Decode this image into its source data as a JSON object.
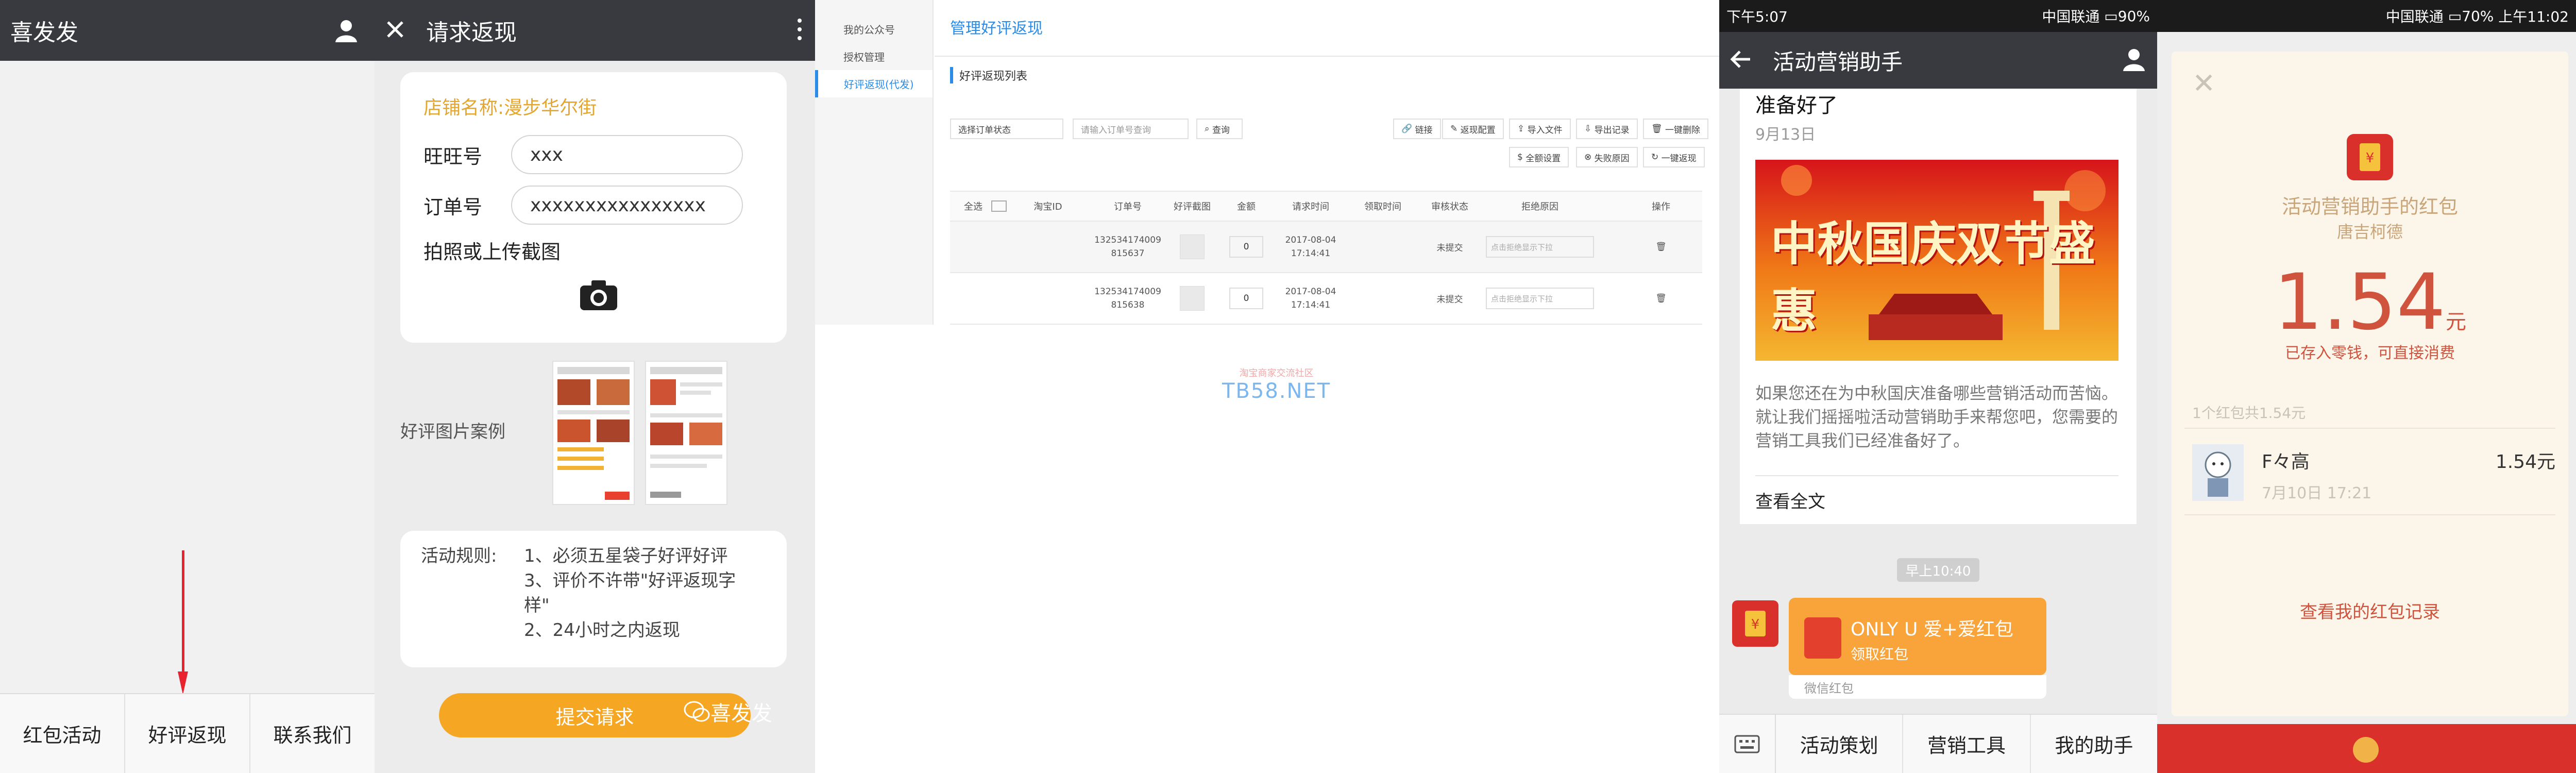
{
  "panel1": {
    "title": "喜发发",
    "tabs": [
      "红包活动",
      "好评返现",
      "联系我们"
    ]
  },
  "panel2": {
    "title": "请求返现",
    "shop_name": "店铺名称:漫步华尔街",
    "wangwang_label": "旺旺号",
    "wangwang_value": "xxx",
    "order_label": "订单号",
    "order_value": "xxxxxxxxxxxxxxxx",
    "upload_label": "拍照或上传截图",
    "example_label": "好评图片案例",
    "rules_label": "活动规则:",
    "rules": [
      "1、必须五星袋子好评好评",
      "3、评价不许带\"好评返现字样\"",
      "2、24小时之内返现"
    ],
    "submit_label": "提交请求",
    "watermark": "喜发发"
  },
  "panel3": {
    "sidebar": {
      "account": "我的公众号",
      "auth": "授权管理",
      "active": "好评返现(代发)"
    },
    "page_title": "管理好评返现",
    "section_title": "好评返现列表",
    "filter_status": "选择订单状态",
    "filter_order_placeholder": "请输入订单号查询",
    "search_label": "查询",
    "tools_row1": [
      "链接",
      "返现配置",
      "导入文件",
      "导出记录",
      "一键删除"
    ],
    "tools_row2": [
      "全额设置",
      "失败原因",
      "一键返现"
    ],
    "headers": [
      "全选",
      "淘宝ID",
      "订单号",
      "好评截图",
      "金额",
      "请求时间",
      "领取时间",
      "审核状态",
      "拒绝原因",
      "操作"
    ],
    "rows": [
      {
        "order_a": "132534174009",
        "order_b": "815637",
        "amount": "0",
        "date": "2017-08-04",
        "time": "17:14:41",
        "status": "未提交",
        "reject_placeholder": "点击拒绝显示下拉"
      },
      {
        "order_a": "132534174009",
        "order_b": "815638",
        "amount": "0",
        "date": "2017-08-04",
        "time": "17:14:41",
        "status": "未提交",
        "reject_placeholder": "点击拒绝显示下拉"
      }
    ],
    "watermark_cn": "淘宝商家交流社区",
    "watermark_en": "TB58.NET"
  },
  "panel4": {
    "status_time": "下午5:07",
    "status_carrier": "中国联通",
    "status_battery": "90%",
    "title": "活动营销助手",
    "article_title": "准备好了",
    "article_date": "9月13日",
    "banner_text": "中秋国庆双节盛惠",
    "article_desc": "如果您还在为中秋国庆准备哪些营销活动而苦恼。就让我们摇摇啦活动营销助手来帮您吧，您需要的营销工具我们已经准备好了。",
    "read_more": "查看全文",
    "timestamp": "早上10:40",
    "hongbao_title": "ONLY U 爱+爱红包",
    "hongbao_action": "领取红包",
    "hongbao_footer": "微信红包",
    "menu": [
      "活动策划",
      "营销工具",
      "我的助手"
    ]
  },
  "panel5": {
    "status_time": "上午11:02",
    "status_carrier": "中国联通",
    "status_battery": "70%",
    "from": "活动营销助手的红包",
    "sender": "唐吉柯德",
    "amount": "1.54",
    "unit": "元",
    "stored": "已存入零钱，可直接消费",
    "count": "1个红包共1.54元",
    "record_name": "F々高",
    "record_date": "7月10日  17:21",
    "record_amount": "1.54元",
    "view_records": "查看我的红包记录"
  },
  "colors": {
    "wechat_header": "#393a3f",
    "accent_orange": "#f5a623",
    "link_blue": "#2a8ce6",
    "hongbao_red": "#d9302b"
  }
}
